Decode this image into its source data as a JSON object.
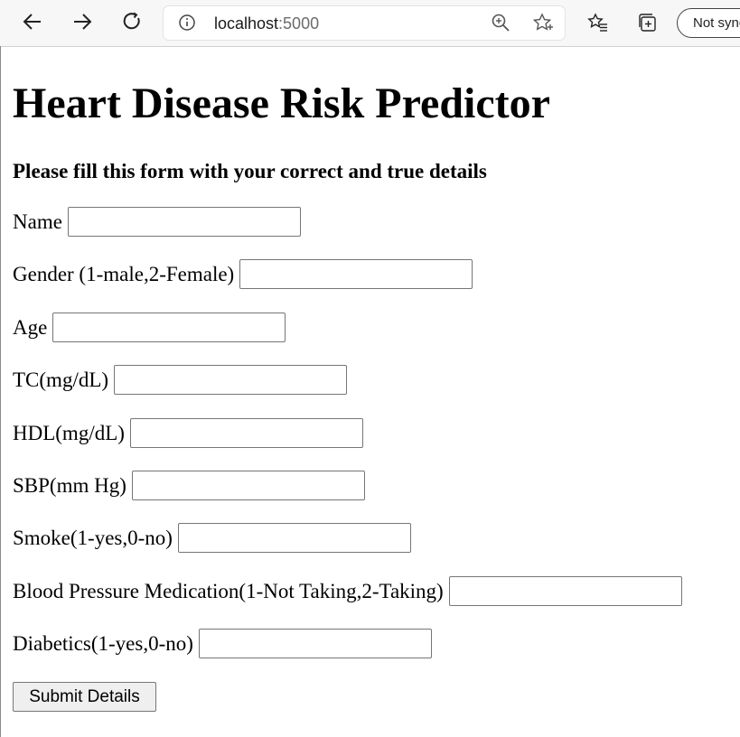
{
  "browser": {
    "url_host": "localhost",
    "url_port": ":5000",
    "sync_label": "Not syncing"
  },
  "page": {
    "title": "Heart Disease Risk Predictor",
    "subtitle": "Please fill this form with your correct and true details"
  },
  "form": {
    "fields": [
      {
        "label": "Name",
        "value": ""
      },
      {
        "label": "Gender (1-male,2-Female)",
        "value": ""
      },
      {
        "label": "Age",
        "value": ""
      },
      {
        "label": "TC(mg/dL)",
        "value": ""
      },
      {
        "label": "HDL(mg/dL)",
        "value": ""
      },
      {
        "label": "SBP(mm Hg)",
        "value": ""
      },
      {
        "label": "Smoke(1-yes,0-no)",
        "value": ""
      },
      {
        "label": "Blood Pressure Medication(1-Not Taking,2-Taking)",
        "value": ""
      },
      {
        "label": "Diabetics(1-yes,0-no)",
        "value": ""
      }
    ],
    "submit_label": "Submit Details"
  }
}
